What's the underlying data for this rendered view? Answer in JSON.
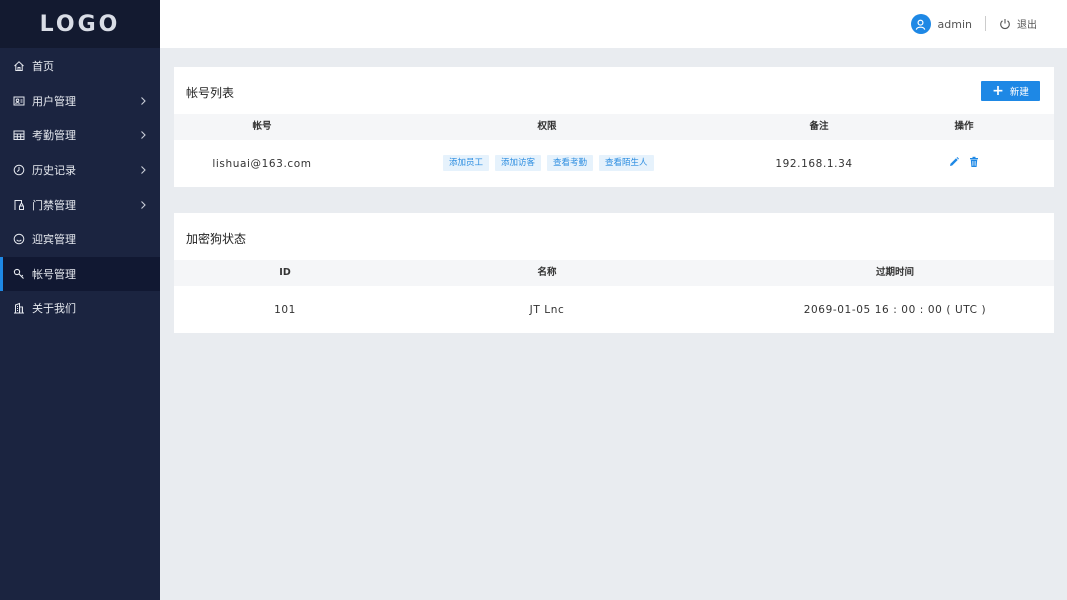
{
  "logo": {
    "text": "LOGO"
  },
  "sidebar": {
    "items": [
      {
        "label": "首页",
        "icon": "home-icon",
        "has_arrow": false,
        "active": false
      },
      {
        "label": "用户管理",
        "icon": "user-card-icon",
        "has_arrow": true,
        "active": false
      },
      {
        "label": "考勤管理",
        "icon": "calendar-grid-icon",
        "has_arrow": true,
        "active": false
      },
      {
        "label": "历史记录",
        "icon": "clock-icon",
        "has_arrow": true,
        "active": false
      },
      {
        "label": "门禁管理",
        "icon": "door-lock-icon",
        "has_arrow": true,
        "active": false
      },
      {
        "label": "迎宾管理",
        "icon": "smile-icon",
        "has_arrow": false,
        "active": false
      },
      {
        "label": "帐号管理",
        "icon": "key-icon",
        "has_arrow": false,
        "active": true
      },
      {
        "label": "关于我们",
        "icon": "building-icon",
        "has_arrow": false,
        "active": false
      }
    ]
  },
  "header": {
    "username": "admin",
    "logout_label": "退出"
  },
  "accounts": {
    "title": "帐号列表",
    "new_label": "新建",
    "columns": [
      "帐号",
      "权限",
      "备注",
      "操作"
    ],
    "rows": [
      {
        "account": "lishuai@163.com",
        "permissions": [
          "添加员工",
          "添加访客",
          "查看考勤",
          "查看陌生人"
        ],
        "remark": "192.168.1.34"
      }
    ]
  },
  "dongle": {
    "title": "加密狗状态",
    "columns": [
      "ID",
      "名称",
      "过期时间"
    ],
    "rows": [
      {
        "id": "101",
        "name": "JT Lnc",
        "expire": "2069-01-05 16 : 00 : 00 ( UTC )"
      }
    ]
  },
  "colors": {
    "sidebar_bg": "#1b2440",
    "accent": "#1e88e5",
    "tag_bg": "#e6f2fc",
    "page_bg": "#e9ecf0"
  }
}
